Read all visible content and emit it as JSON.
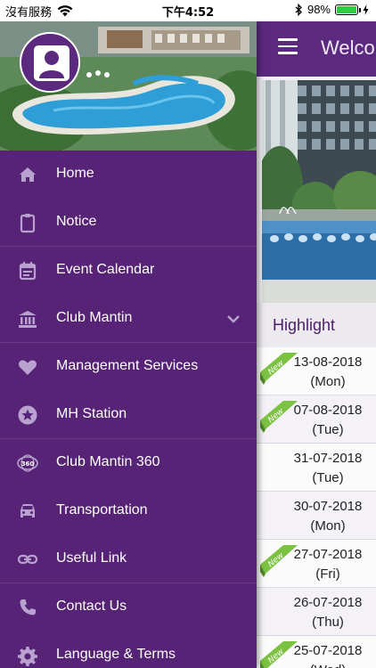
{
  "status_bar": {
    "carrier": "沒有服務",
    "time": "下午4:52",
    "battery_percent": "98%",
    "battery_level": 0.98
  },
  "header": {
    "welcome_text": "Welco"
  },
  "highlight": {
    "title": "Highlight",
    "items": [
      {
        "date": "13-08-2018",
        "day": "(Mon)",
        "is_new": true,
        "new_label": "New"
      },
      {
        "date": "07-08-2018",
        "day": "(Tue)",
        "is_new": true,
        "new_label": "New"
      },
      {
        "date": "31-07-2018",
        "day": "(Tue)",
        "is_new": false
      },
      {
        "date": "30-07-2018",
        "day": "(Mon)",
        "is_new": false
      },
      {
        "date": "27-07-2018",
        "day": "(Fri)",
        "is_new": true,
        "new_label": "New"
      },
      {
        "date": "26-07-2018",
        "day": "(Thu)",
        "is_new": false
      },
      {
        "date": "25-07-2018",
        "day": "(Wed)",
        "is_new": true,
        "new_label": "New"
      }
    ]
  },
  "drawer": {
    "menu": [
      {
        "label": "Home",
        "icon": "home-icon"
      },
      {
        "label": "Notice",
        "icon": "clipboard-icon"
      },
      {
        "label": "Event Calendar",
        "icon": "calendar-icon"
      },
      {
        "label": "Club Mantin",
        "icon": "bank-icon",
        "expandable": true
      },
      {
        "label": "Management Services",
        "icon": "heart-icon"
      },
      {
        "label": "MH Station",
        "icon": "star-icon"
      },
      {
        "label": "Club Mantin 360",
        "icon": "360-icon"
      },
      {
        "label": "Transportation",
        "icon": "car-icon"
      },
      {
        "label": "Useful Link",
        "icon": "link-icon"
      },
      {
        "label": "Contact Us",
        "icon": "phone-icon"
      },
      {
        "label": "Language & Terms",
        "icon": "gear-icon"
      }
    ],
    "icon_360_text": "360"
  },
  "colors": {
    "drawer_bg": "#572376",
    "topbar_bg": "#5b2a7f",
    "icon_tint": "#b9a2cf",
    "new_ribbon": "#7cc242"
  }
}
